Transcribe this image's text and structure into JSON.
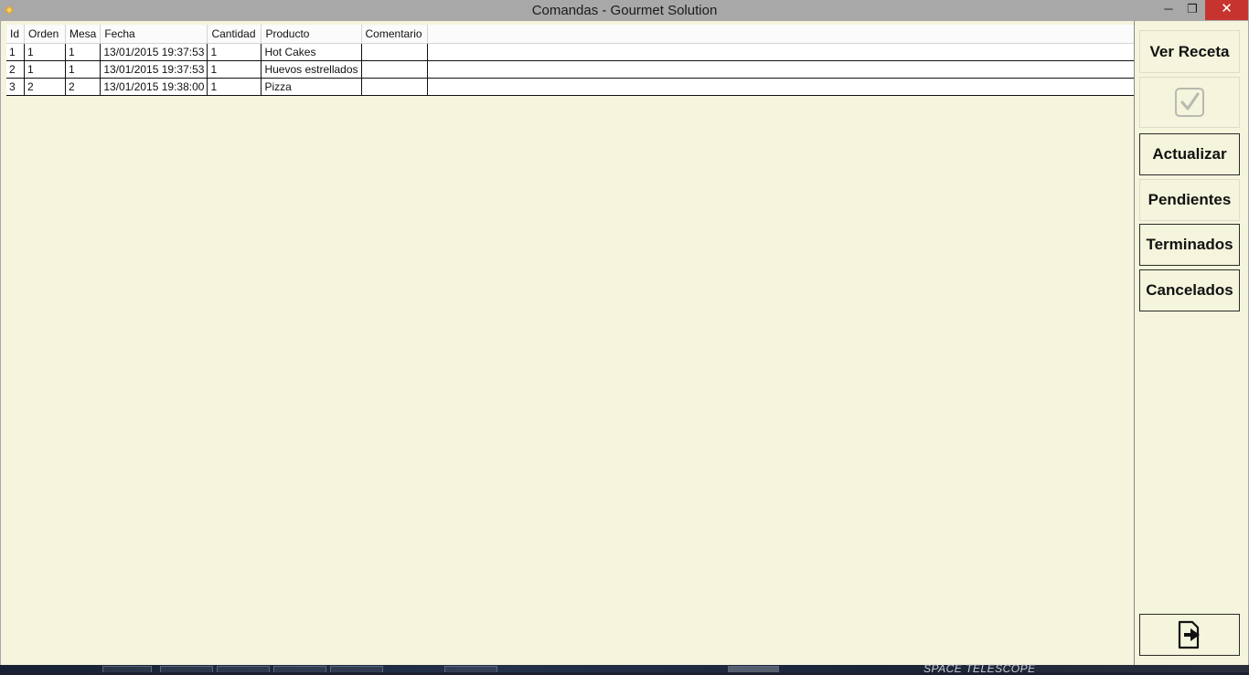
{
  "window": {
    "title": "Comandas - Gourmet Solution",
    "controls": {
      "minimize": "─",
      "maximize": "❐",
      "close": "✕"
    }
  },
  "grid": {
    "columns": [
      "Id",
      "Orden",
      "Mesa",
      "Fecha",
      "Cantidad",
      "Producto",
      "Comentario"
    ],
    "rows": [
      [
        "1",
        "1",
        "1",
        "13/01/2015 19:37:53",
        "1",
        "Hot Cakes",
        ""
      ],
      [
        "2",
        "1",
        "1",
        "13/01/2015 19:37:53",
        "1",
        "Huevos estrellados",
        ""
      ],
      [
        "3",
        "2",
        "2",
        "13/01/2015 19:38:00",
        "1",
        "Pizza",
        ""
      ]
    ]
  },
  "sidebar": {
    "ver_receta": "Ver Receta",
    "check_icon": "check-icon",
    "actualizar": "Actualizar",
    "pendientes": "Pendientes",
    "terminados": "Terminados",
    "cancelados": "Cancelados",
    "exit_icon": "exit-icon"
  },
  "taskbar": {
    "wallpaper_text": "SPACE TELESCOPE"
  },
  "colors": {
    "background": "#f5f4dc",
    "titlebar": "#a8a8a8",
    "close": "#c7342d"
  }
}
